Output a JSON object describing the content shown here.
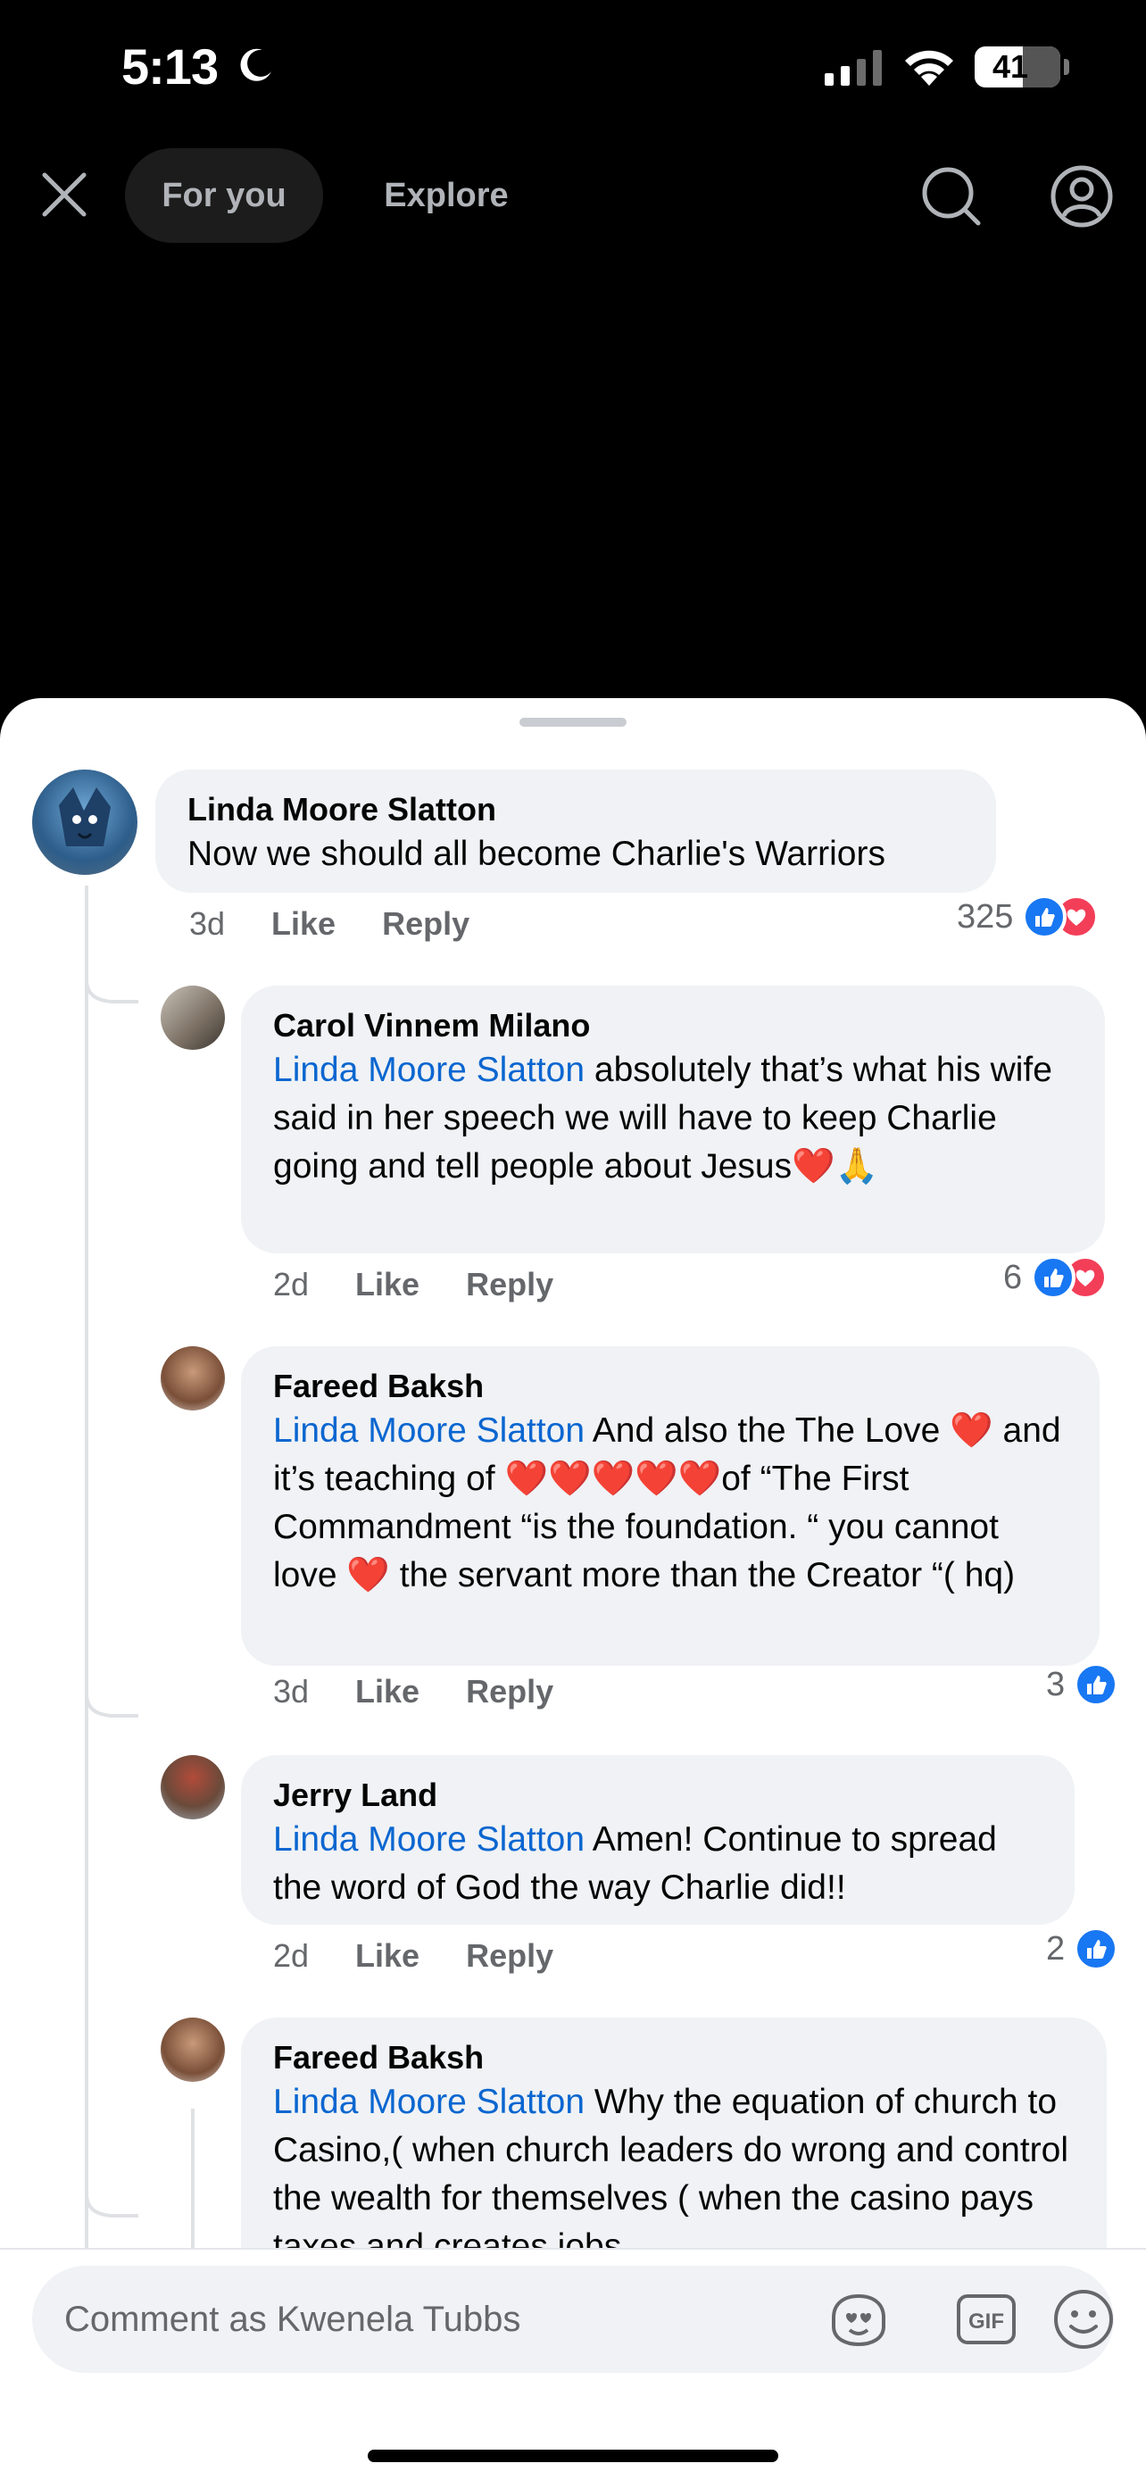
{
  "status_bar": {
    "time": "5:13",
    "battery": "41"
  },
  "nav": {
    "tabs": [
      "For you",
      "Explore"
    ]
  },
  "comments": [
    {
      "author": "Linda Moore Slatton",
      "mention": "",
      "text": "Now we should all become Charlie's Warriors",
      "time": "3d",
      "like": "Like",
      "reply": "Reply",
      "reaction_count": "325",
      "reactions": [
        "like-icon",
        "love-icon"
      ]
    },
    {
      "author": "Carol Vinnem Milano",
      "mention": "Linda Moore Slatton",
      "text": " absolutely that’s what his wife said in her speech we will have to keep Charlie going and tell people about Jesus❤️🙏",
      "time": "2d",
      "like": "Like",
      "reply": "Reply",
      "reaction_count": "6",
      "reactions": [
        "like-icon",
        "love-icon"
      ]
    },
    {
      "author": "Fareed Baksh",
      "mention": "Linda Moore Slatton",
      "text": " And also the The Love ❤️ and it’s teaching of ❤️❤️❤️❤️❤️of “The First Commandment “is the foundation. “ you cannot love ❤️ the servant more than the Creator “( hq)",
      "time": "3d",
      "like": "Like",
      "reply": "Reply",
      "reaction_count": "3",
      "reactions": [
        "like-icon"
      ]
    },
    {
      "author": "Jerry Land",
      "mention": "Linda Moore Slatton",
      "text": " Amen!  Continue to spread the word of God the way Charlie did!!",
      "time": "2d",
      "like": "Like",
      "reply": "Reply",
      "reaction_count": "2",
      "reactions": [
        "like-icon"
      ]
    },
    {
      "author": "Fareed Baksh",
      "mention": "Linda Moore Slatton",
      "text": " Why the equation of church to Casino,( when church leaders do wrong and control the wealth for themselves ( when the casino pays taxes and creates jobs"
    }
  ],
  "comment_bar": {
    "placeholder": "Comment as Kwenela Tubbs",
    "gif_label": "GIF"
  },
  "colors": {
    "like": "#1877f2",
    "love": "#f33e58",
    "mention": "#0a66d0",
    "bubble": "#f0f2f5"
  }
}
